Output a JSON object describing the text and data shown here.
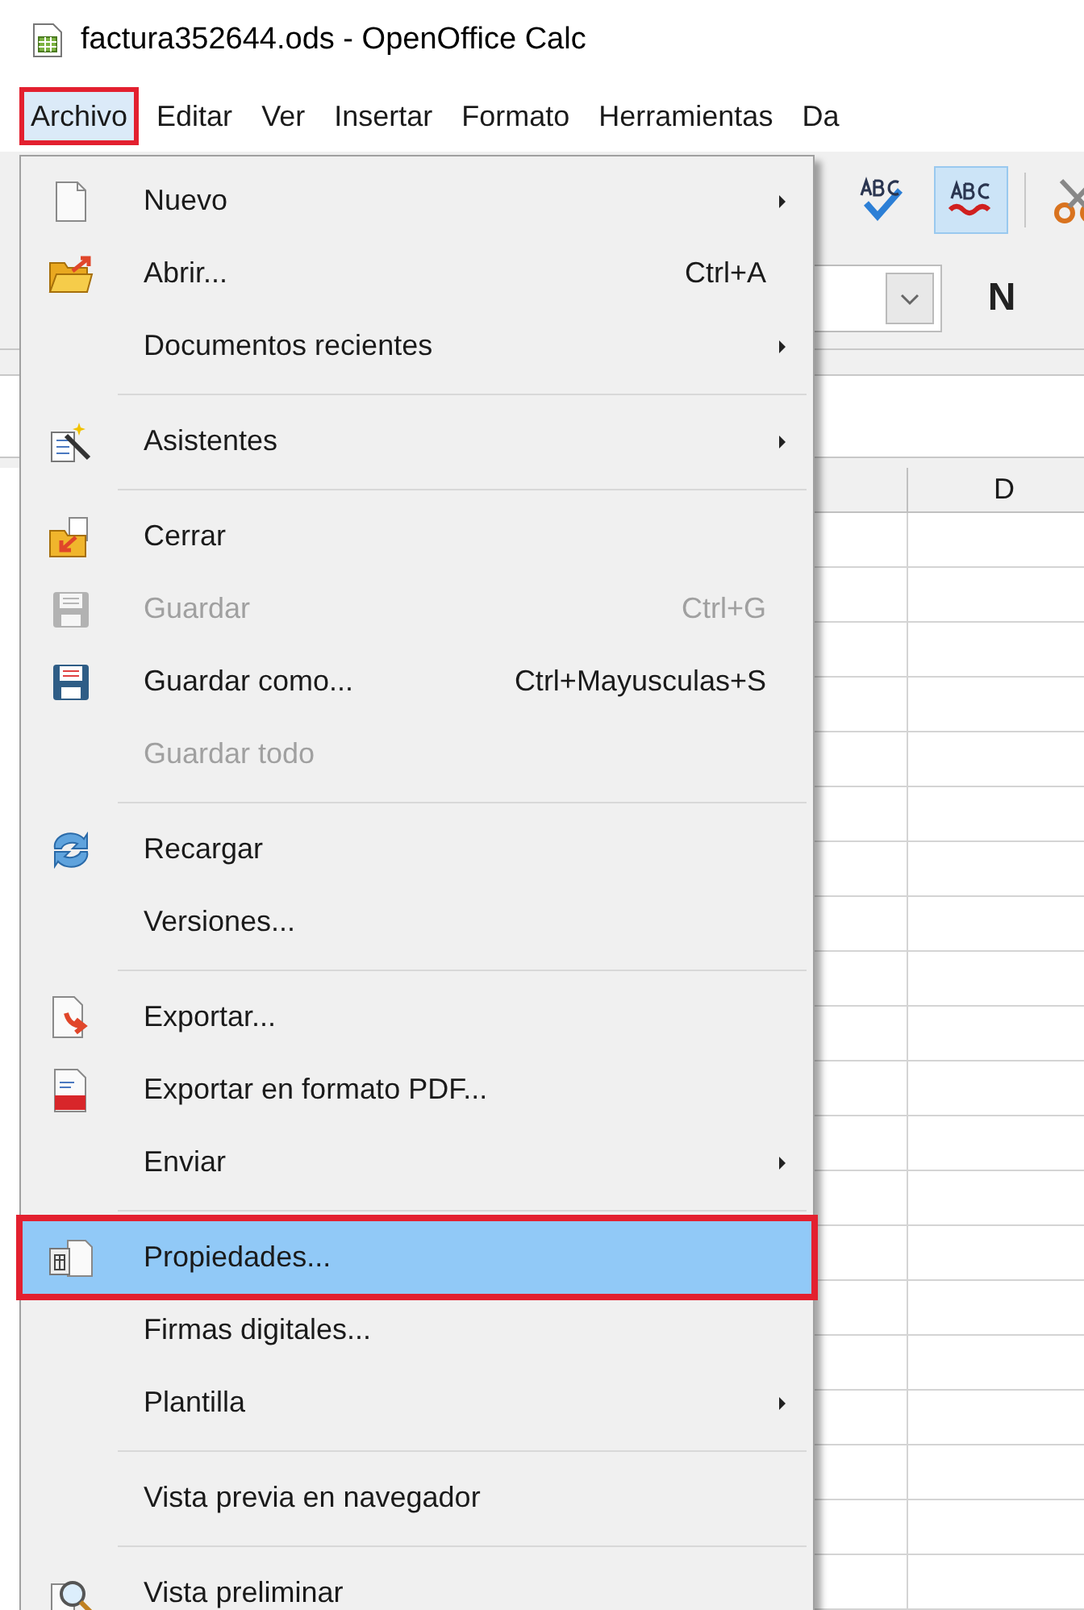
{
  "window": {
    "title": "factura352644.ods - OpenOffice Calc"
  },
  "menu_bar": [
    {
      "label": "Archivo",
      "selected": true
    },
    {
      "label": "Editar",
      "selected": false
    },
    {
      "label": "Ver",
      "selected": false
    },
    {
      "label": "Insertar",
      "selected": false
    },
    {
      "label": "Formato",
      "selected": false
    },
    {
      "label": "Herramientas",
      "selected": false
    },
    {
      "label": "Da",
      "selected": false
    }
  ],
  "toolbar": [
    {
      "kind": "spellcheck",
      "pressed": false
    },
    {
      "kind": "autospell",
      "pressed": true
    },
    {
      "kind": "cut",
      "pressed": false
    }
  ],
  "format_bar": {
    "bold_label": "N"
  },
  "sheet": {
    "columns": [
      "",
      "D"
    ]
  },
  "file_menu": [
    {
      "kind": "item",
      "label": "Nuevo",
      "submenu": true,
      "disabled": false,
      "selected": false
    },
    {
      "kind": "item",
      "label": "Abrir...",
      "shortcut": "Ctrl+A",
      "submenu": false,
      "disabled": false,
      "selected": false
    },
    {
      "kind": "item",
      "label": "Documentos recientes",
      "submenu": true,
      "disabled": false,
      "selected": false
    },
    {
      "kind": "separator"
    },
    {
      "kind": "item",
      "label": "Asistentes",
      "submenu": true,
      "disabled": false,
      "selected": false
    },
    {
      "kind": "separator"
    },
    {
      "kind": "item",
      "label": "Cerrar",
      "submenu": false,
      "disabled": false,
      "selected": false
    },
    {
      "kind": "item",
      "label": "Guardar",
      "shortcut": "Ctrl+G",
      "submenu": false,
      "disabled": true,
      "selected": false
    },
    {
      "kind": "item",
      "label": "Guardar como...",
      "shortcut": "Ctrl+Mayusculas+S",
      "submenu": false,
      "disabled": false,
      "selected": false
    },
    {
      "kind": "item",
      "label": "Guardar todo",
      "submenu": false,
      "disabled": true,
      "selected": false
    },
    {
      "kind": "separator"
    },
    {
      "kind": "item",
      "label": "Recargar",
      "submenu": false,
      "disabled": false,
      "selected": false
    },
    {
      "kind": "item",
      "label": "Versiones...",
      "submenu": false,
      "disabled": false,
      "selected": false
    },
    {
      "kind": "separator"
    },
    {
      "kind": "item",
      "label": "Exportar...",
      "submenu": false,
      "disabled": false,
      "selected": false
    },
    {
      "kind": "item",
      "label": "Exportar en formato PDF...",
      "submenu": false,
      "disabled": false,
      "selected": false
    },
    {
      "kind": "item",
      "label": "Enviar",
      "submenu": true,
      "disabled": false,
      "selected": false
    },
    {
      "kind": "separator"
    },
    {
      "kind": "item",
      "label": "Propiedades...",
      "submenu": false,
      "disabled": false,
      "selected": true
    },
    {
      "kind": "item",
      "label": "Firmas digitales...",
      "submenu": false,
      "disabled": false,
      "selected": false
    },
    {
      "kind": "item",
      "label": "Plantilla",
      "submenu": true,
      "disabled": false,
      "selected": false
    },
    {
      "kind": "separator"
    },
    {
      "kind": "item",
      "label": "Vista previa en navegador",
      "submenu": false,
      "disabled": false,
      "selected": false
    },
    {
      "kind": "separator"
    },
    {
      "kind": "item",
      "label": "Vista preliminar",
      "submenu": false,
      "disabled": false,
      "selected": false
    }
  ]
}
